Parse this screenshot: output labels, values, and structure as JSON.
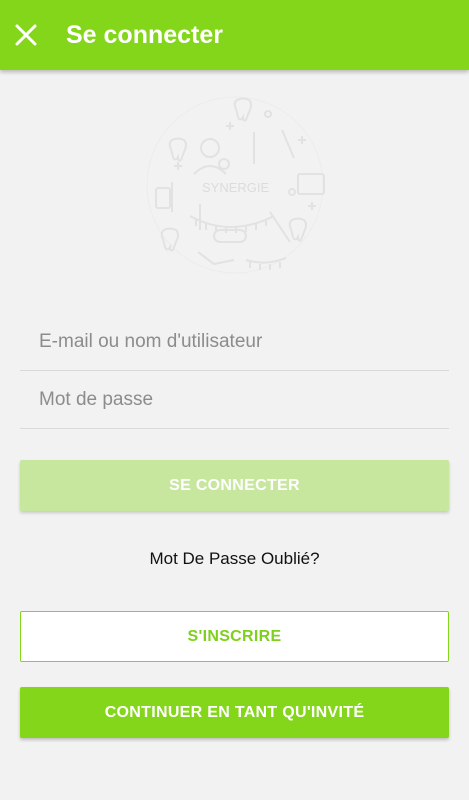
{
  "header": {
    "title": "Se connecter",
    "close_icon": "close-icon",
    "background_color": "#84d61a"
  },
  "logo": {
    "text": "SYNERGIE",
    "icon": "dental-logo-icon"
  },
  "form": {
    "email_placeholder": "E-mail ou nom d'utilisateur",
    "password_placeholder": "Mot de passe",
    "login_label": "SE CONNECTER",
    "forgot_label": "Mot De Passe Oublié?",
    "register_label": "S'INSCRIRE",
    "guest_label": "CONTINUER EN TANT QU'INVITÉ"
  },
  "colors": {
    "accent": "#84d61a",
    "login_disabled": "#c8e79e",
    "background": "#f2f2f2"
  }
}
